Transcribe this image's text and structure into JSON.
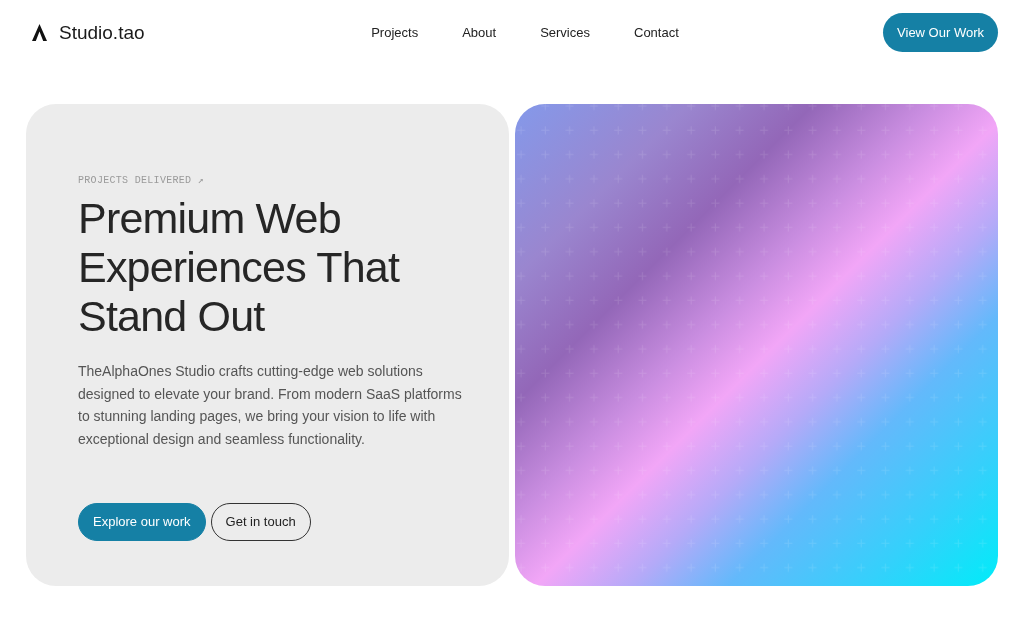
{
  "header": {
    "logo_text": "Studio.tao",
    "nav": [
      "Projects",
      "About",
      "Services",
      "Contact"
    ],
    "cta": "View Our Work"
  },
  "hero": {
    "eyebrow": "PROJECTS DELIVERED ↗",
    "title": "Premium Web Experiences That Stand Out",
    "description": "TheAlphaOnes Studio crafts cutting-edge web solutions designed to elevate your brand. From modern SaaS platforms to stunning landing pages, we bring your vision to life with exceptional design and seamless functionality.",
    "buttons": [
      {
        "label": "Explore our work",
        "kind": "primary"
      },
      {
        "label": "Get in touch",
        "kind": "outline"
      }
    ]
  }
}
